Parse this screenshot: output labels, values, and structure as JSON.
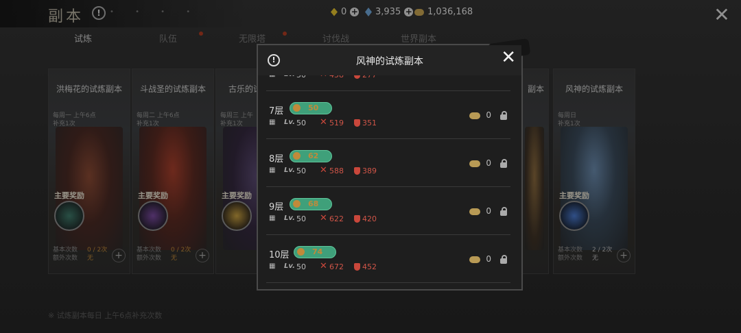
{
  "screen": {
    "title": "副本",
    "currencies": [
      {
        "icon": "gold-gem-icon",
        "value": "0"
      },
      {
        "icon": "blue-crystal-icon",
        "value": "3,935"
      },
      {
        "icon": "coin-icon",
        "value": "1,036,168"
      }
    ],
    "tabs": [
      {
        "label": "试炼",
        "active": true,
        "dot": false
      },
      {
        "label": "队伍",
        "active": false,
        "dot": true
      },
      {
        "label": "无限塔",
        "active": false,
        "dot": true
      },
      {
        "label": "讨伐战",
        "active": false,
        "dot": false
      },
      {
        "label": "世界副本",
        "active": false,
        "dot": false
      }
    ]
  },
  "cards": [
    {
      "title": "洪梅花的试炼副本",
      "schedule": "每周一 上午6点\n补充1次",
      "reward_label": "主要奖励",
      "count_labels": "基本次数\n额外次数",
      "count_values": "0 / 2次\n无",
      "accent": "#7a3b2a"
    },
    {
      "title": "斗战圣的试炼副本",
      "schedule": "每周二 上午6点\n补充1次",
      "reward_label": "主要奖励",
      "count_labels": "基本次数\n额外次数",
      "count_values": "0 / 2次\n无",
      "accent": "#8b2b1f"
    },
    {
      "title": "古乐的试",
      "schedule": "每周三 上午\n补充1次",
      "reward_label": "主要奖励",
      "count_labels": "基本次数\n额外次数",
      "count_values": "",
      "accent": "#4a3560"
    },
    {
      "title": "风神的试炼副本",
      "schedule": "每周日\n补充1次",
      "reward_label": "主要奖励",
      "count_labels": "基本次数\n额外次数",
      "count_values": "2 / 2次\n无",
      "accent": "#4f6f8a"
    }
  ],
  "partial_card_title": "副本",
  "modal": {
    "title": "风神的试炼副本",
    "rows": [
      {
        "floor": "",
        "power": "",
        "level": "50",
        "attack": "458",
        "defense": "277",
        "reward": "",
        "partial": true
      },
      {
        "floor": "7层",
        "power": "50",
        "level": "50",
        "attack": "519",
        "defense": "351",
        "reward": "0"
      },
      {
        "floor": "8层",
        "power": "62",
        "level": "50",
        "attack": "588",
        "defense": "389",
        "reward": "0"
      },
      {
        "floor": "9层",
        "power": "68",
        "level": "50",
        "attack": "622",
        "defense": "420",
        "reward": "0"
      },
      {
        "floor": "10层",
        "power": "74",
        "level": "50",
        "attack": "672",
        "defense": "452",
        "reward": "0"
      }
    ],
    "lv_label": "Lv."
  },
  "footer_note": "※ 试炼副本每日 上午6点补充次数"
}
